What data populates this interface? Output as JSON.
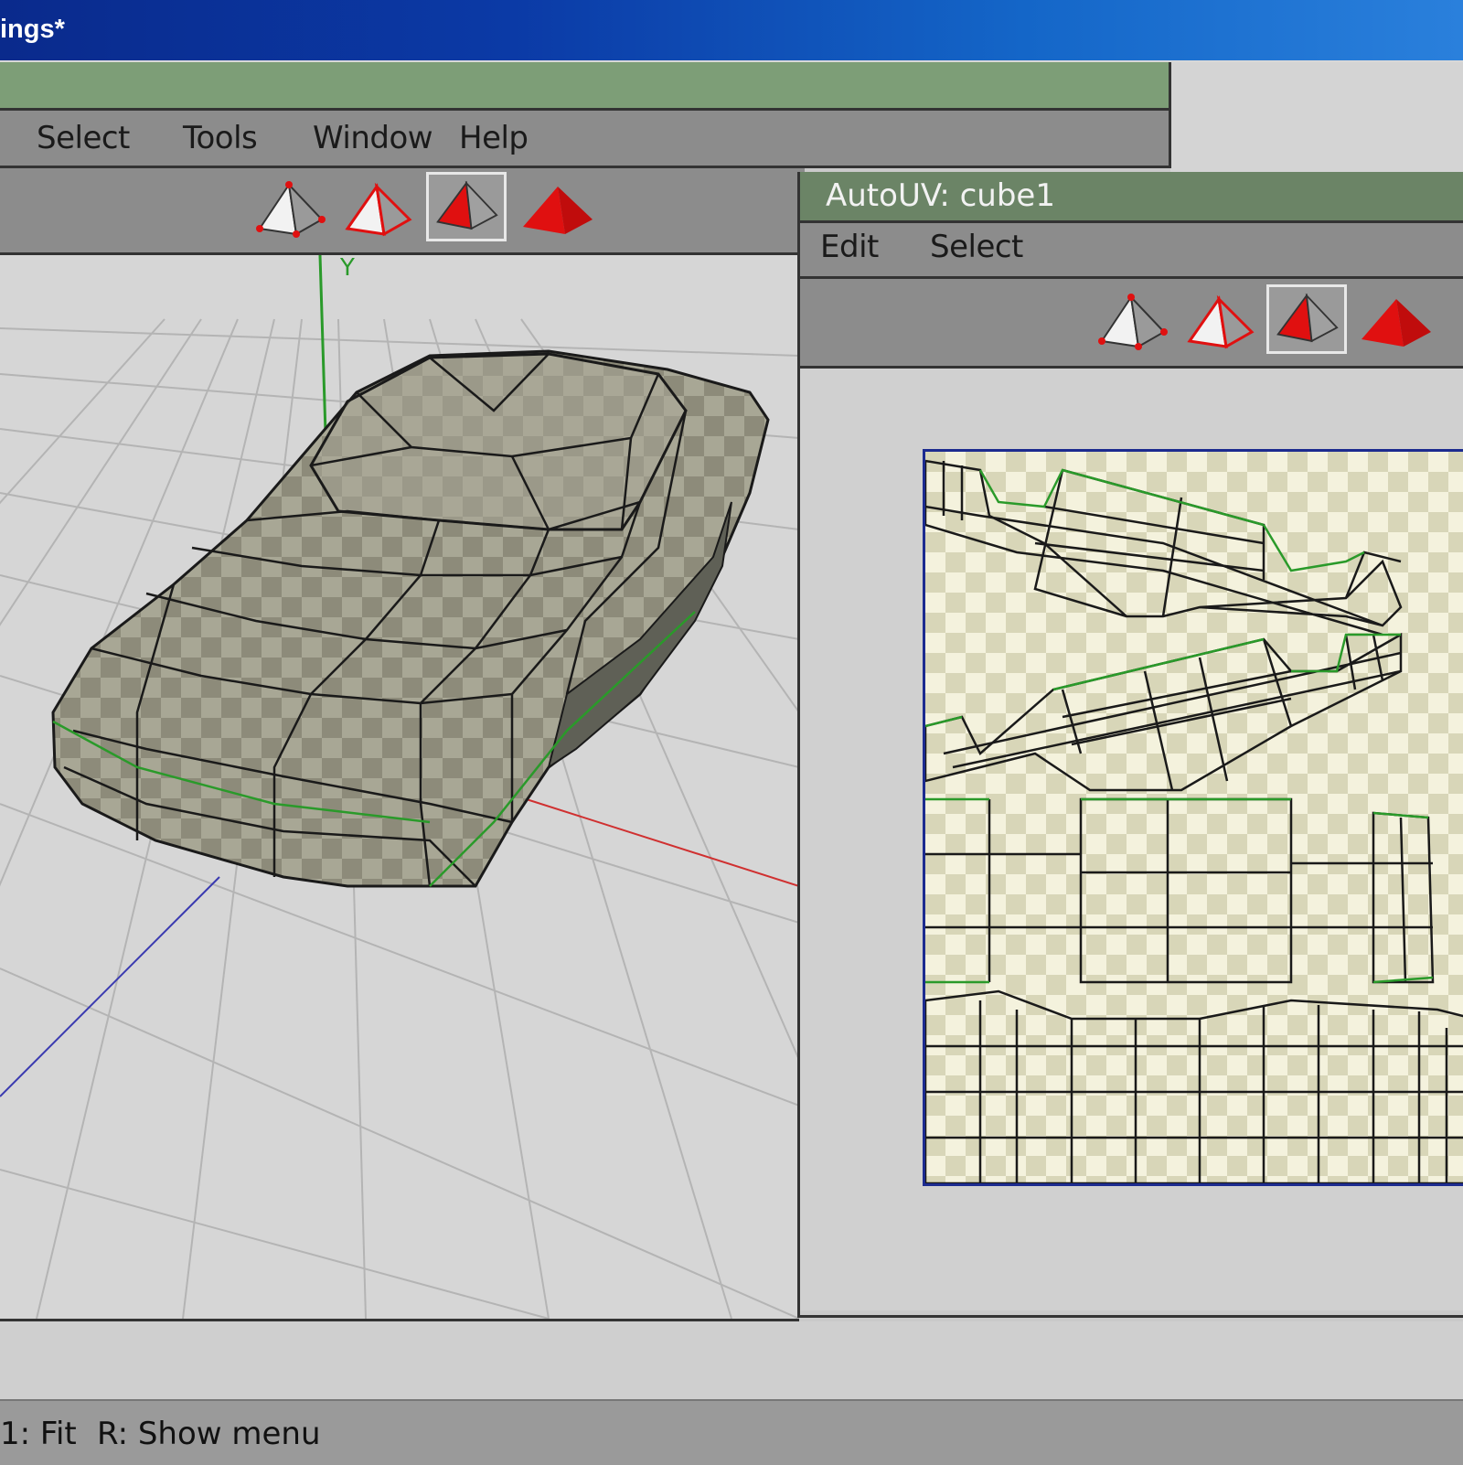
{
  "window": {
    "title": "ings*"
  },
  "menubar": {
    "items": [
      "Select",
      "Tools",
      "Window",
      "Help"
    ]
  },
  "toolbar": {
    "modes": [
      "vertex",
      "edge",
      "face",
      "body"
    ],
    "active": "face"
  },
  "autouv": {
    "title": "AutoUV: cube1",
    "menu": [
      "Edit",
      "Select"
    ],
    "toolbar": {
      "modes": [
        "vertex",
        "edge",
        "face",
        "body"
      ],
      "active": "face"
    }
  },
  "viewport": {
    "axis_label": "Y"
  },
  "status": {
    "left": "1: Fit",
    "right": "R: Show menu"
  },
  "colors": {
    "title_gradient_start": "#0a2a8c",
    "title_gradient_end": "#2a80dc",
    "green_bar": "#7d9e77",
    "uv_title": "#6b8466",
    "selection_red": "#e01010",
    "green_edge": "#2a9a2a"
  }
}
